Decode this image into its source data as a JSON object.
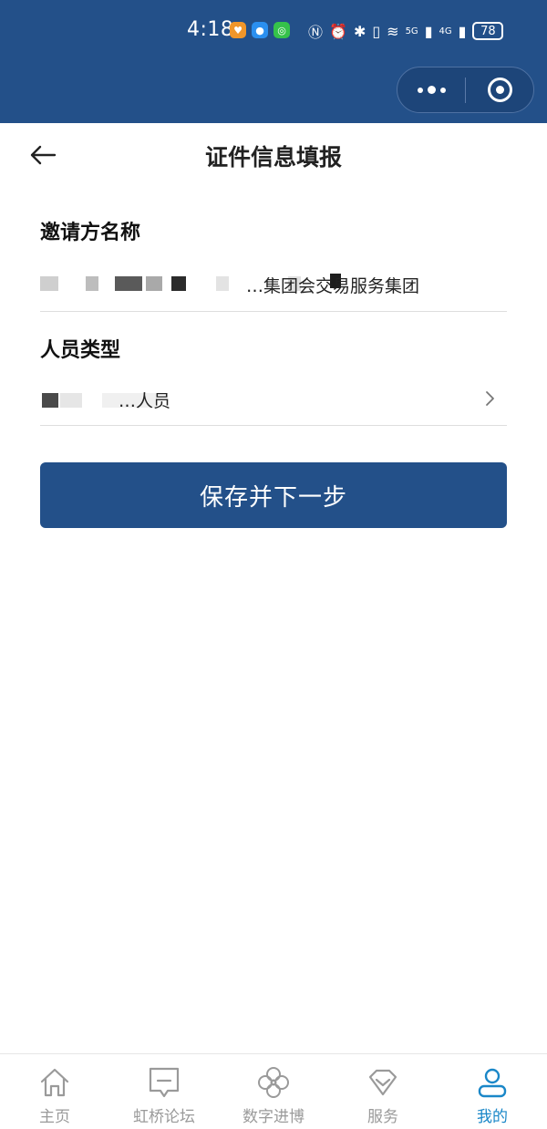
{
  "status_bar": {
    "time": "4:18",
    "battery": "78",
    "network_1": "5G",
    "network_2": "4G"
  },
  "colors": {
    "brand": "#235089",
    "active_tab": "#1a87c8"
  },
  "header": {
    "title": "证件信息填报"
  },
  "form": {
    "inviter": {
      "label": "邀请方名称",
      "value": "联合会……………集团",
      "visible_suffix": "…集团会交易服务集团"
    },
    "personnel_type": {
      "label": "人员类型",
      "value": "…人员"
    },
    "save_label": "保存并下一步"
  },
  "tabbar": {
    "items": [
      {
        "label": "主页",
        "icon": "home-icon",
        "active": false
      },
      {
        "label": "虹桥论坛",
        "icon": "chat-icon",
        "active": false
      },
      {
        "label": "数字进博",
        "icon": "clover-icon",
        "active": false
      },
      {
        "label": "服务",
        "icon": "diamond-icon",
        "active": false
      },
      {
        "label": "我的",
        "icon": "user-icon",
        "active": true
      }
    ]
  }
}
